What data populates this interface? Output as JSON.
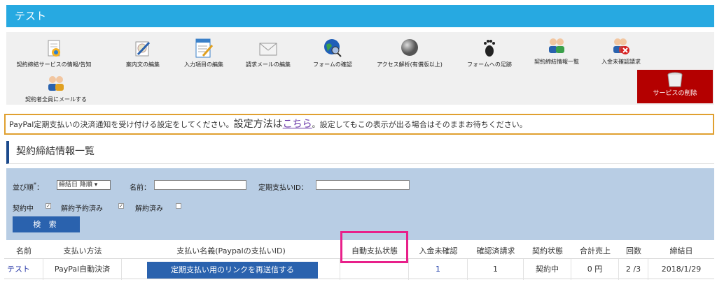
{
  "title": "テスト",
  "toolbar": {
    "items": [
      {
        "label": "契約締結サービスの情報/告知",
        "icon": "document-info-icon"
      },
      {
        "label": "案内文の編集",
        "icon": "paint-edit-icon"
      },
      {
        "label": "入力項目の編集",
        "icon": "form-edit-icon"
      },
      {
        "label": "請求メールの編集",
        "icon": "mail-icon"
      },
      {
        "label": "フォームの確認",
        "icon": "globe-search-icon"
      },
      {
        "label": "アクセス解析(有償版以上)",
        "icon": "sphere-icon"
      },
      {
        "label": "フォームへの足跡",
        "icon": "footprint-icon"
      },
      {
        "label": "契約締結情報一覧",
        "icon": "users-icon"
      },
      {
        "label": "入金未確認請求",
        "icon": "users-remove-icon"
      },
      {
        "label": "契約者全員にメールする",
        "icon": "users-mail-icon"
      }
    ],
    "delete_label": "サービスの削除"
  },
  "notice": {
    "pre": "PayPal定期支払いの決済通知を受け付ける設定をしてください。",
    "big": "設定方法は",
    "link": "こちら",
    "post": "。設定してもこの表示が出る場合はそのままお待ちください。"
  },
  "section_title": "契約締結情報一覧",
  "search": {
    "sort_label": "並び順",
    "sort_mark": "*",
    "sort_colon": "：",
    "sort_value": "締結日 降順 ▾",
    "name_label": "名前：",
    "id_label": "定期支払いID：",
    "status_active": "契約中",
    "status_reserved": "解約予約済み",
    "status_cancelled": "解約済み",
    "check_mark": "✓",
    "search_button": "検 索"
  },
  "table": {
    "headers": [
      "名前",
      "支払い方法",
      "支払い名義(Paypalの支払いID)",
      "自動支払状態",
      "入金未確認",
      "確認済請求",
      "契約状態",
      "合計売上",
      "回数",
      "締結日"
    ],
    "row": {
      "name": "テスト",
      "method": "PayPal自動決済",
      "resend_button": "定期支払い用のリンクを再送信する",
      "auto_status": "",
      "unconfirmed": "1",
      "confirmed": "1",
      "contract_state": "契約中",
      "total_sales": "0 円",
      "count": "2 /3",
      "date": "2018/1/29"
    }
  },
  "colors": {
    "title_bar": "#27a9e1",
    "button_blue": "#2a62ae",
    "delete_red": "#b40000",
    "notice_border": "#e0a030",
    "highlight": "#e8208a",
    "search_panel": "#b8cde4"
  }
}
